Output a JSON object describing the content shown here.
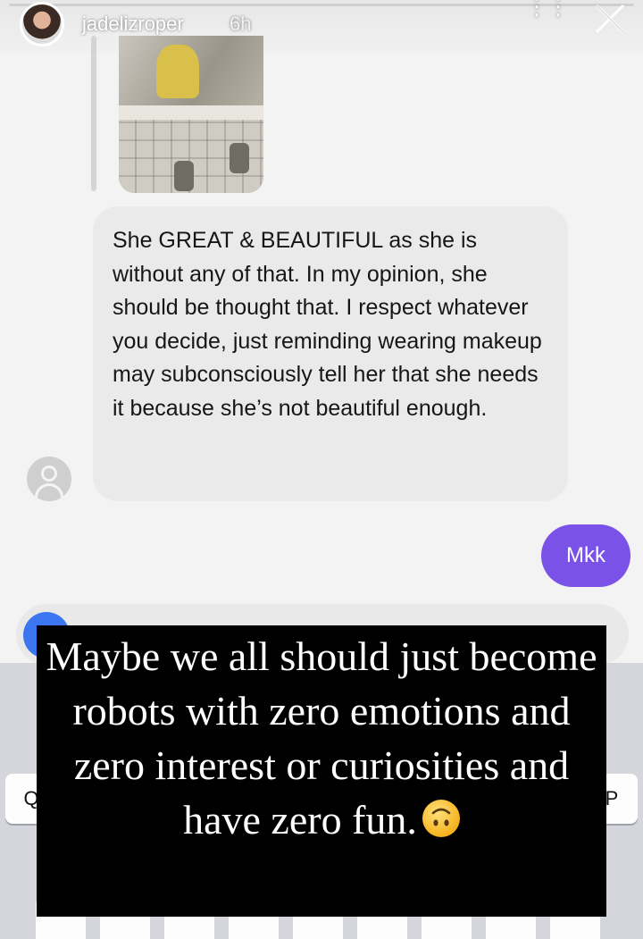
{
  "story": {
    "username": "jadelizroper",
    "timestamp": "6h"
  },
  "conversation": {
    "incoming_message": "She GREAT & BEAUTIFUL as she is without any of that. In my opinion, she should be thought that. I respect whatever you decide, just reminding wearing makeup may subconsciously tell her that she needs it because she’s not beautiful enough.",
    "outgoing_message": "Mkk"
  },
  "keyboard": {
    "left_key": "Q",
    "right_key": "P"
  },
  "overlay": {
    "caption": "Maybe we all should just become robots with zero emotions and zero interest or curiosities and have zero fun.",
    "emoji": "upside-down-face"
  },
  "colors": {
    "outgoing_bubble": "#7b52e8",
    "incoming_bubble": "#eaeaea",
    "camera_button": "#3b76f0",
    "overlay_background": "#000000"
  }
}
